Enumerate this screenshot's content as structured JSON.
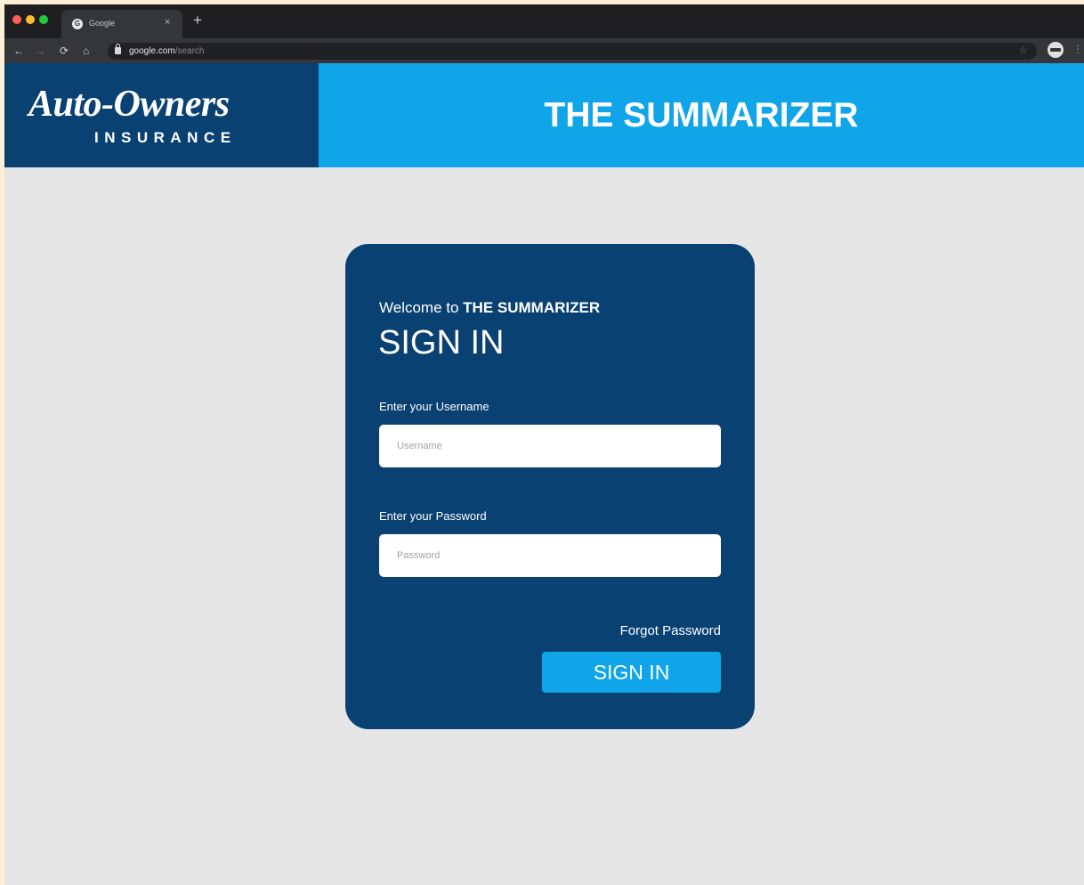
{
  "browser": {
    "tab_title": "Google",
    "favicon_letter": "G",
    "close_glyph": "×",
    "new_tab_glyph": "+",
    "url_domain": "google.com",
    "url_path": "/search"
  },
  "header": {
    "logo_main": "Auto-Owners",
    "logo_sub": "INSURANCE",
    "title": "THE SUMMARIZER"
  },
  "signin": {
    "welcome_prefix": "Welcome to ",
    "welcome_bold": "THE SUMMARIZER",
    "title": "SIGN IN",
    "username_label": "Enter your Username",
    "username_placeholder": "Username",
    "username_value": "",
    "password_label": "Enter your Password",
    "password_placeholder": "Password",
    "password_value": "",
    "forgot_label": "Forgot Password",
    "button_label": "SIGN IN"
  },
  "colors": {
    "navy": "#0a4173",
    "sky": "#10a4e8",
    "page_bg": "#e6e6e6"
  },
  "icons": [
    "back-arrow-icon",
    "forward-arrow-icon",
    "reload-icon",
    "home-icon",
    "lock-icon",
    "star-icon",
    "profile-icon",
    "menu-icon"
  ]
}
